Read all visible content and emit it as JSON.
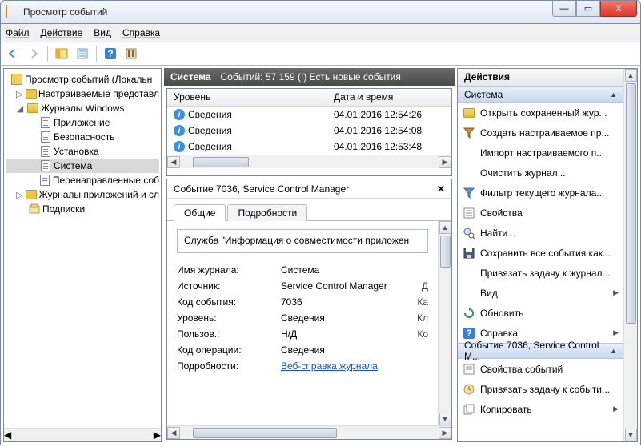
{
  "window": {
    "title": "Просмотр событий"
  },
  "menu": {
    "file": "Файл",
    "action": "Действие",
    "view": "Вид",
    "help": "Справка"
  },
  "tree": {
    "root": "Просмотр событий (Локальн",
    "custom": "Настраиваемые представл",
    "winlogs": "Журналы Windows",
    "app": "Приложение",
    "security": "Безопасность",
    "setup": "Установка",
    "system": "Система",
    "forwarded": "Перенаправленные соб",
    "applogs": "Журналы приложений и сл",
    "subs": "Подписки"
  },
  "center": {
    "title": "Система",
    "count": "Событий: 57 159 (!) Есть новые события",
    "cols": {
      "level": "Уровень",
      "datetime": "Дата и время"
    },
    "rows": [
      {
        "level": "Сведения",
        "dt": "04.01.2016 12:54:26"
      },
      {
        "level": "Сведения",
        "dt": "04.01.2016 12:54:08"
      },
      {
        "level": "Сведения",
        "dt": "04.01.2016 12:53:48"
      }
    ],
    "detail": {
      "title": "Событие 7036, Service Control Manager",
      "tabs": {
        "general": "Общие",
        "details": "Подробности"
      },
      "desc": "Служба \"Информация о совместимости приложен",
      "props": {
        "logname_k": "Имя журнала:",
        "logname_v": "Система",
        "source_k": "Источник:",
        "source_v": "Service Control Manager",
        "source_r": "Д",
        "eventid_k": "Код события:",
        "eventid_v": "7036",
        "eventid_r": "Ка",
        "level_k": "Уровень:",
        "level_v": "Сведения",
        "level_r": "Кл",
        "user_k": "Пользов.:",
        "user_v": "Н/Д",
        "user_r": "Ко",
        "opcode_k": "Код операции:",
        "opcode_v": "Сведения",
        "more_k": "Подробности:",
        "more_v": "Веб-справка журнала"
      }
    }
  },
  "actions": {
    "header": "Действия",
    "group1": "Система",
    "items1": [
      "Открыть сохраненный жур...",
      "Создать настраиваемое пр...",
      "Импорт настраиваемого п...",
      "Очистить журнал...",
      "Фильтр текущего журнала...",
      "Свойства",
      "Найти...",
      "Сохранить все события как...",
      "Привязать задачу к журнал...",
      "Вид",
      "Обновить",
      "Справка"
    ],
    "group2": "Событие 7036, Service Control M...",
    "items2": [
      "Свойства событий",
      "Привязать задачу к событи...",
      "Копировать"
    ]
  }
}
